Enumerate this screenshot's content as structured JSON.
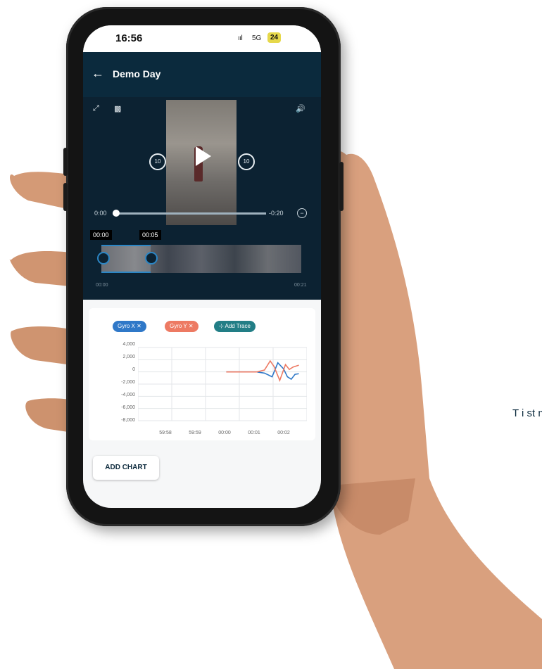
{
  "status_bar": {
    "time": "16:56",
    "signal": "ııl",
    "network": "5G",
    "battery": "24"
  },
  "app_bar": {
    "back_icon": "arrow-left-icon",
    "title": "Demo Day"
  },
  "video": {
    "current_time": "0:00",
    "remaining_time": "-0:20",
    "skip_back": "10",
    "skip_forward": "10",
    "progress": 0
  },
  "timeline": {
    "start_tag": "00:00",
    "end_tag": "00:05",
    "left_label": "00:00",
    "right_label": "00:21"
  },
  "chart_card": {
    "chips": [
      {
        "label": "Gyro X  ✕",
        "color": "#2f78c8"
      },
      {
        "label": "Gyro Y  ✕",
        "color": "#ed7a63"
      },
      {
        "label": "⊹ Add Trace",
        "color": "#227e86"
      }
    ]
  },
  "chart_data": {
    "type": "line",
    "y_ticks": [
      "4,000",
      "2,000",
      "0",
      "-2,000",
      "-4,000",
      "-6,000",
      "-8,000"
    ],
    "x_ticks": [
      "59:58",
      "59:59",
      "00:00",
      "00:01",
      "00:02"
    ],
    "ylim": [
      -8000,
      4000
    ],
    "series": [
      {
        "name": "Gyro X",
        "color": "#2f78c8",
        "x": [
          2.2,
          2.6,
          3.0,
          3.2,
          3.4,
          3.55,
          3.7,
          3.8,
          3.9,
          4.0,
          4.1
        ],
        "y": [
          0,
          0,
          0,
          -200,
          -800,
          1500,
          500,
          -800,
          -1200,
          -400,
          -300
        ]
      },
      {
        "name": "Gyro Y",
        "color": "#ed7a63",
        "x": [
          2.2,
          2.6,
          3.0,
          3.2,
          3.35,
          3.45,
          3.6,
          3.75,
          3.85,
          3.95,
          4.1
        ],
        "y": [
          0,
          0,
          0,
          300,
          1800,
          900,
          -1400,
          1200,
          400,
          800,
          1100
        ]
      }
    ]
  },
  "add_chart_label": "ADD CHART",
  "side_text": "T i st m"
}
